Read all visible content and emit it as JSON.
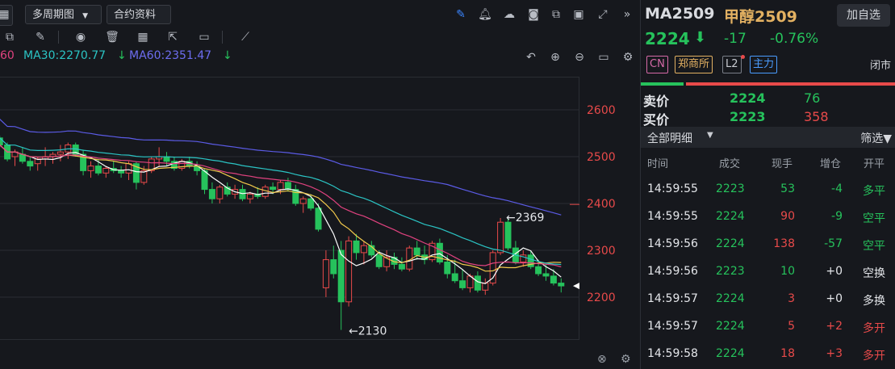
{
  "toolbar": {
    "period_dropdown": "多周期图",
    "contract_info": "合约资料"
  },
  "legend": {
    "ma20_fragment": "60",
    "ma30": "MA30:2270.77",
    "ma60": "MA60:2351.47"
  },
  "chart_data": {
    "type": "candlestick",
    "y_ticks": [
      2600,
      2500,
      2400,
      2300,
      2200
    ],
    "ylim": [
      2100,
      2680
    ],
    "annotations": [
      {
        "text": "←2369",
        "value": 2369
      },
      {
        "text": "←2130",
        "value": 2130
      }
    ],
    "price_marker_value": 2224,
    "marker_color_red": "#e84a4a",
    "marker_color_green": "#26c25c",
    "ma_colors": {
      "ma5": "#ffffff",
      "ma10": "#f2c94c",
      "ma20": "#e0427f",
      "ma30": "#2bc4c4",
      "ma60": "#5b5be6"
    },
    "candles": [
      [
        2540,
        2545,
        2520,
        2525
      ],
      [
        2525,
        2530,
        2490,
        2495
      ],
      [
        2500,
        2515,
        2480,
        2510
      ],
      [
        2505,
        2520,
        2485,
        2490
      ],
      [
        2490,
        2500,
        2470,
        2480
      ],
      [
        2485,
        2500,
        2470,
        2495
      ],
      [
        2495,
        2520,
        2480,
        2500
      ],
      [
        2500,
        2510,
        2485,
        2505
      ],
      [
        2505,
        2525,
        2490,
        2510
      ],
      [
        2510,
        2530,
        2495,
        2525
      ],
      [
        2525,
        2530,
        2500,
        2505
      ],
      [
        2505,
        2515,
        2460,
        2470
      ],
      [
        2470,
        2490,
        2455,
        2480
      ],
      [
        2480,
        2495,
        2460,
        2465
      ],
      [
        2465,
        2480,
        2455,
        2475
      ],
      [
        2475,
        2490,
        2465,
        2470
      ],
      [
        2470,
        2480,
        2455,
        2465
      ],
      [
        2465,
        2490,
        2450,
        2485
      ],
      [
        2485,
        2490,
        2430,
        2445
      ],
      [
        2445,
        2480,
        2440,
        2470
      ],
      [
        2470,
        2500,
        2465,
        2495
      ],
      [
        2495,
        2520,
        2480,
        2500
      ],
      [
        2500,
        2510,
        2480,
        2490
      ],
      [
        2490,
        2500,
        2470,
        2475
      ],
      [
        2475,
        2495,
        2470,
        2490
      ],
      [
        2490,
        2500,
        2475,
        2480
      ],
      [
        2480,
        2490,
        2460,
        2470
      ],
      [
        2470,
        2475,
        2420,
        2430
      ],
      [
        2430,
        2445,
        2400,
        2410
      ],
      [
        2410,
        2440,
        2400,
        2435
      ],
      [
        2435,
        2445,
        2415,
        2420
      ],
      [
        2420,
        2440,
        2410,
        2430
      ],
      [
        2430,
        2440,
        2405,
        2410
      ],
      [
        2410,
        2425,
        2400,
        2420
      ],
      [
        2420,
        2435,
        2410,
        2415
      ],
      [
        2415,
        2440,
        2410,
        2435
      ],
      [
        2435,
        2445,
        2420,
        2430
      ],
      [
        2430,
        2450,
        2420,
        2445
      ],
      [
        2445,
        2455,
        2425,
        2430
      ],
      [
        2430,
        2440,
        2395,
        2400
      ],
      [
        2400,
        2415,
        2380,
        2410
      ],
      [
        2410,
        2420,
        2385,
        2390
      ],
      [
        2390,
        2400,
        2340,
        2345
      ],
      [
        2220,
        2300,
        2200,
        2280
      ],
      [
        2280,
        2310,
        2240,
        2250
      ],
      [
        2300,
        2320,
        2130,
        2190
      ],
      [
        2190,
        2330,
        2180,
        2320
      ],
      [
        2320,
        2335,
        2280,
        2295
      ],
      [
        2295,
        2320,
        2270,
        2310
      ],
      [
        2310,
        2320,
        2285,
        2290
      ],
      [
        2290,
        2300,
        2260,
        2265
      ],
      [
        2265,
        2300,
        2255,
        2285
      ],
      [
        2285,
        2295,
        2260,
        2270
      ],
      [
        2270,
        2285,
        2255,
        2260
      ],
      [
        2260,
        2310,
        2255,
        2305
      ],
      [
        2305,
        2320,
        2280,
        2290
      ],
      [
        2290,
        2310,
        2270,
        2280
      ],
      [
        2280,
        2320,
        2275,
        2315
      ],
      [
        2315,
        2325,
        2270,
        2275
      ],
      [
        2275,
        2290,
        2240,
        2250
      ],
      [
        2250,
        2280,
        2230,
        2235
      ],
      [
        2235,
        2260,
        2215,
        2220
      ],
      [
        2220,
        2250,
        2210,
        2245
      ],
      [
        2245,
        2255,
        2210,
        2215
      ],
      [
        2215,
        2240,
        2205,
        2230
      ],
      [
        2230,
        2300,
        2225,
        2295
      ],
      [
        2295,
        2369,
        2290,
        2360
      ],
      [
        2360,
        2369,
        2300,
        2305
      ],
      [
        2305,
        2320,
        2270,
        2275
      ],
      [
        2275,
        2300,
        2265,
        2290
      ],
      [
        2290,
        2300,
        2260,
        2265
      ],
      [
        2265,
        2280,
        2245,
        2250
      ],
      [
        2250,
        2270,
        2235,
        2245
      ],
      [
        2245,
        2260,
        2225,
        2230
      ],
      [
        2230,
        2240,
        2210,
        2224
      ]
    ]
  },
  "right": {
    "symbol": "MA2509",
    "name": "甲醇2509",
    "add_watch": "加自选",
    "price": "2224",
    "change": "-17",
    "percent": "-0.76%",
    "badges": [
      "CN",
      "郑商所",
      "L2",
      "主力"
    ],
    "status": "闭市",
    "ask_label": "卖价",
    "ask_price": "2224",
    "ask_vol": "76",
    "bid_label": "买价",
    "bid_price": "2223",
    "bid_vol": "358",
    "detail_title": "全部明细",
    "filter": "筛选",
    "columns": [
      "时间",
      "成交",
      "现手",
      "增仓",
      "开平"
    ],
    "trades": [
      {
        "time": "14:59:55",
        "price": "2223",
        "vol": "53",
        "oi": "-4",
        "type": "多平",
        "vc": "#26c25c",
        "oc": "#26c25c"
      },
      {
        "time": "14:59:55",
        "price": "2224",
        "vol": "90",
        "oi": "-9",
        "type": "空平",
        "vc": "#e84a4a",
        "oc": "#26c25c"
      },
      {
        "time": "14:59:56",
        "price": "2224",
        "vol": "138",
        "oi": "-57",
        "type": "空平",
        "vc": "#e84a4a",
        "oc": "#26c25c"
      },
      {
        "time": "14:59:56",
        "price": "2223",
        "vol": "10",
        "oi": "+0",
        "type": "空换",
        "vc": "#26c25c",
        "oc": "#e4e6ea"
      },
      {
        "time": "14:59:57",
        "price": "2224",
        "vol": "3",
        "oi": "+0",
        "type": "多换",
        "vc": "#e84a4a",
        "oc": "#e4e6ea"
      },
      {
        "time": "14:59:57",
        "price": "2224",
        "vol": "5",
        "oi": "+2",
        "type": "多开",
        "vc": "#e84a4a",
        "oc": "#e84a4a"
      },
      {
        "time": "14:59:58",
        "price": "2224",
        "vol": "18",
        "oi": "+3",
        "type": "多开",
        "vc": "#e84a4a",
        "oc": "#e84a4a"
      }
    ]
  }
}
